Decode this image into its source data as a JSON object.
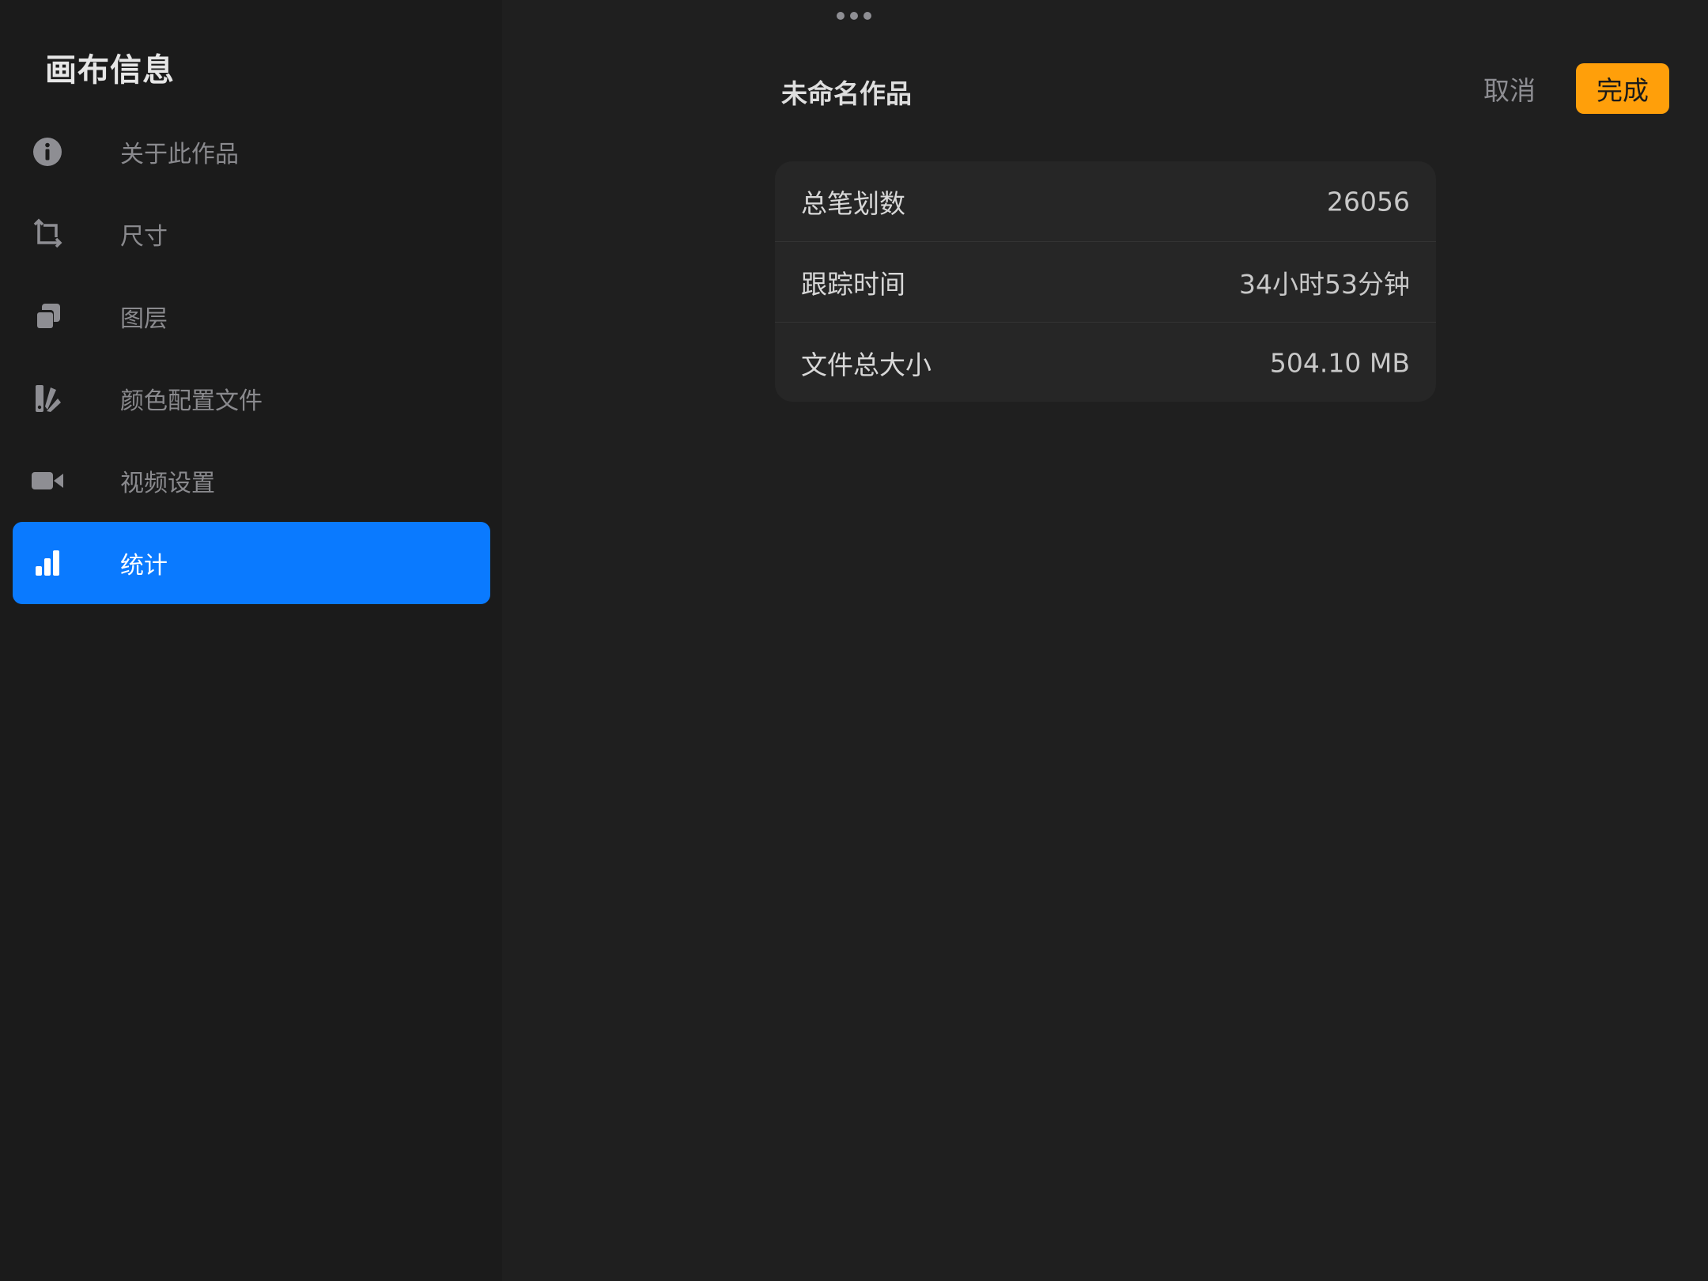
{
  "sidebar": {
    "title": "画布信息",
    "items": [
      {
        "label": "关于此作品",
        "icon": "info-icon"
      },
      {
        "label": "尺寸",
        "icon": "crop-icon"
      },
      {
        "label": "图层",
        "icon": "layers-icon"
      },
      {
        "label": "颜色配置文件",
        "icon": "color-swatch-icon"
      },
      {
        "label": "视频设置",
        "icon": "video-camera-icon"
      },
      {
        "label": "统计",
        "icon": "bar-chart-icon",
        "active": true
      }
    ]
  },
  "header": {
    "title": "未命名作品",
    "cancel_label": "取消",
    "done_label": "完成"
  },
  "stats": [
    {
      "key": "总笔划数",
      "value": "26056"
    },
    {
      "key": "跟踪时间",
      "value": "34小时53分钟"
    },
    {
      "key": "文件总大小",
      "value": "504.10 MB"
    }
  ],
  "colors": {
    "accent_blue": "#0a7aff",
    "done_orange": "#ff9f0a",
    "sidebar_bg": "#1b1b1b",
    "main_bg": "#1f1f1f",
    "card_bg": "#262626"
  }
}
